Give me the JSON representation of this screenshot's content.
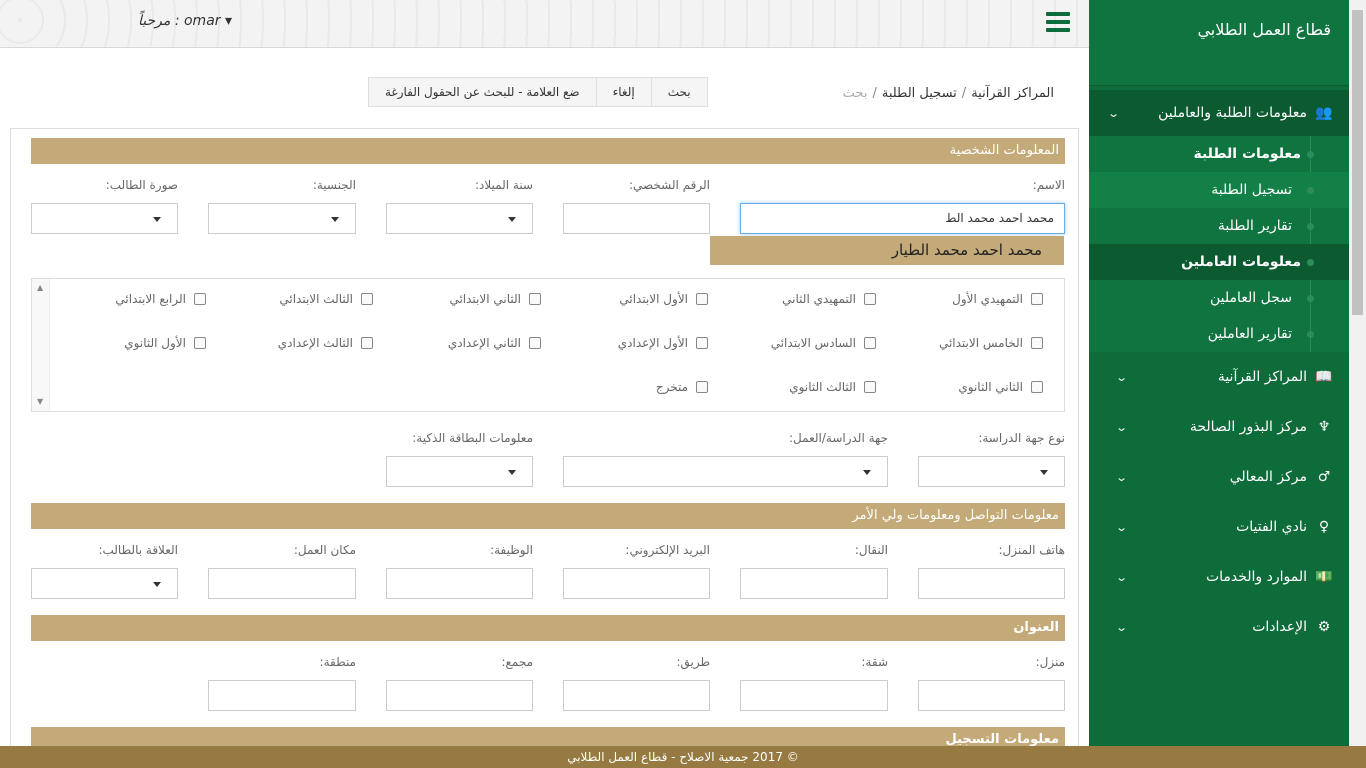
{
  "header": {
    "welcome": "مرحباً : omar ▾"
  },
  "sidebar": {
    "brand": "قطاع العمل الطلابي",
    "section": "معلومات الطلبة والعاملين",
    "sub": [
      {
        "label": "معلومات الطلبة"
      },
      {
        "label": "تسجيل الطلبة"
      },
      {
        "label": "تقارير الطلبة"
      },
      {
        "label": "معلومات العاملين"
      },
      {
        "label": "سجل العاملين"
      },
      {
        "label": "تقارير العاملين"
      }
    ],
    "items": [
      {
        "label": "المراكز القرآنية",
        "icon": "book-icon",
        "glyph": "📖"
      },
      {
        "label": "مركز البذور الصالحة",
        "icon": "child-icon",
        "glyph": "♆"
      },
      {
        "label": "مركز المعالي",
        "icon": "male-icon",
        "glyph": "♂"
      },
      {
        "label": "نادي الفتيات",
        "icon": "female-icon",
        "glyph": "♀"
      },
      {
        "label": "الموارد والخدمات",
        "icon": "money-icon",
        "glyph": "💵"
      },
      {
        "label": "الإعدادات",
        "icon": "cogs-icon",
        "glyph": "⚙"
      }
    ]
  },
  "breadcrumb": {
    "item1": "المراكز القرآنية",
    "item2": "تسجيل الطلبة",
    "current": "بحث"
  },
  "toolbar": {
    "search": "بحث",
    "cancel": "إلغاء",
    "hint": "ضع العلامة - للبحث عن الحقول الفارغة"
  },
  "personal": {
    "title": "المعلومات الشخصية",
    "name_label": "الاسم:",
    "name_value": "محمد احمد محمد الط",
    "civil_label": "الرقم الشخصي:",
    "birth_label": "سنة الميلاد:",
    "nationality_label": "الجنسية:",
    "photo_label": "صورة الطالب:",
    "suggestion": "محمد احمد محمد الطيار"
  },
  "grades": [
    "التمهيدي الأول",
    "التمهيدي الثاني",
    "الأول الابتدائي",
    "الثاني الابتدائي",
    "الثالث الابتدائي",
    "الرابع الابتدائي",
    "الخامس الابتدائي",
    "السادس الابتدائي",
    "الأول الإعدادي",
    "الثاني الإعدادي",
    "الثالث الإعدادي",
    "الأول الثانوي",
    "الثاني الثانوي",
    "الثالث الثانوي",
    "متخرج"
  ],
  "study": {
    "type_label": "نوع جهة الدراسة:",
    "place_label": "جهة الدراسة/العمل:",
    "card_label": "معلومات البطاقة الذكية:"
  },
  "contact": {
    "title": "معلومات التواصل ومعلومات ولي الأمر",
    "home_phone": "هاتف المنزل:",
    "mobile": "النقال:",
    "email": "البريد الإلكتروني:",
    "job": "الوظيفة:",
    "workplace": "مكان العمل:",
    "relation": "العلاقة بالطالب:"
  },
  "address": {
    "title": "العنوان",
    "house": "منزل:",
    "flat": "شقة:",
    "road": "طريق:",
    "block": "مجمع:",
    "area": "منطقة:"
  },
  "registration": {
    "title": "معلومات التسجيل"
  },
  "footer": "© 2017 جمعية الاصلاح - قطاع العمل الطلابي"
}
